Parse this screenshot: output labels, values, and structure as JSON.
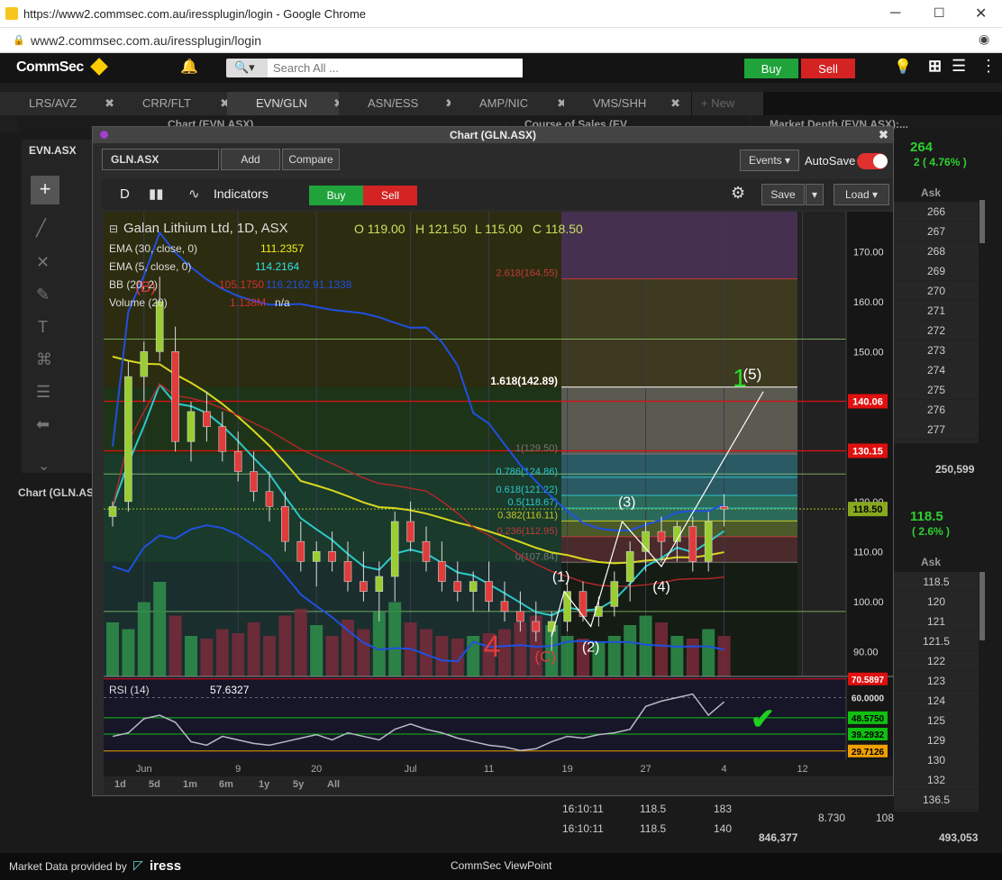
{
  "browser": {
    "tab_title": "https://www2.commsec.com.au/iressplugin/login - Google Chrome",
    "url": "www2.commsec.com.au/iressplugin/login"
  },
  "app": {
    "logo": "CommSec",
    "search_placeholder": "Search All ...",
    "buy_label": "Buy",
    "sell_label": "Sell"
  },
  "tabs": [
    {
      "label": "LRS/AVZ"
    },
    {
      "label": "CRR/FLT"
    },
    {
      "label": "EVN/GLN"
    },
    {
      "label": "ASN/ESS"
    },
    {
      "label": "AMP/NIC"
    },
    {
      "label": "VMS/SHH"
    },
    {
      "label": "+ New"
    }
  ],
  "panels": {
    "left_chart": "Chart (EVN.ASX)",
    "course_of_sales": "Course of Sales (EV...",
    "market_depth": "Market Depth (EVN.ASX):...",
    "left_symbol": "EVN.ASX",
    "left_bottom": "Chart (GLN.ASX)"
  },
  "depth_top": {
    "price": "264",
    "change": "2 ( 4.76% )",
    "ask_header": "Ask",
    "asks": [
      "266",
      "267",
      "268",
      "269",
      "270",
      "271",
      "272",
      "273",
      "274",
      "275",
      "276",
      "277"
    ],
    "total": "250,599"
  },
  "depth_bottom": {
    "price": "118.5",
    "change": "( 2.6% )",
    "ask_header": "Ask",
    "asks": [
      "118.5",
      "120",
      "121",
      "121.5",
      "122",
      "123",
      "124",
      "125",
      "129",
      "130",
      "132",
      "136.5"
    ],
    "bid_price": "8.730",
    "bid_vol": "108",
    "total_left": "846,377",
    "total_right": "493,053"
  },
  "course_of_sales_rows": [
    {
      "time": "16:10:11",
      "price": "118.5",
      "vol": "183"
    },
    {
      "time": "16:10:11",
      "price": "118.5",
      "vol": "140"
    }
  ],
  "modal": {
    "title": "Chart (GLN.ASX)",
    "symbol": "GLN.ASX",
    "add_label": "Add",
    "compare_label": "Compare",
    "events_label": "Events",
    "autosave_label": "AutoSave",
    "period_label": "D",
    "indicators_label": "Indicators",
    "buy_label": "Buy",
    "sell_label": "Sell",
    "save_label": "Save",
    "load_label": "Load"
  },
  "timeframes": [
    "1d",
    "5d",
    "1m",
    "6m",
    "1y",
    "5y",
    "All"
  ],
  "footer": {
    "provided_by": "Market Data provided by",
    "brand": "iress",
    "app_name": "CommSec ViewPoint"
  },
  "chart_data": {
    "type": "candlestick",
    "title": "Galan Lithium Ltd, 1D, ASX",
    "ohlc_header": {
      "o": "O 119.00",
      "h": "H 121.50",
      "l": "L 115.00",
      "c": "C 118.50"
    },
    "ylim": [
      85,
      178
    ],
    "yticks": [
      90,
      100,
      110,
      120,
      130,
      140,
      150,
      160,
      170
    ],
    "ytick_labels": [
      "90.00",
      "100.00",
      "110.00",
      "120.00",
      "130.00",
      "140.00",
      "150.00",
      "160.00",
      "170.00"
    ],
    "xticks": [
      {
        "i": 2,
        "label": "Jun"
      },
      {
        "i": 8,
        "label": "9"
      },
      {
        "i": 13,
        "label": "20"
      },
      {
        "i": 19,
        "label": "Jul"
      },
      {
        "i": 24,
        "label": "11"
      },
      {
        "i": 29,
        "label": "19"
      },
      {
        "i": 34,
        "label": "27"
      },
      {
        "i": 39,
        "label": "4"
      },
      {
        "i": 44,
        "label": "12"
      }
    ],
    "candles": [
      [
        117,
        120,
        115,
        119
      ],
      [
        120,
        148,
        118,
        145
      ],
      [
        145,
        152,
        140,
        150
      ],
      [
        150,
        165,
        148,
        160
      ],
      [
        150,
        155,
        130,
        132
      ],
      [
        132,
        140,
        128,
        138
      ],
      [
        138,
        142,
        132,
        135
      ],
      [
        135,
        138,
        128,
        130
      ],
      [
        130,
        134,
        124,
        126
      ],
      [
        126,
        130,
        120,
        122
      ],
      [
        122,
        126,
        116,
        119
      ],
      [
        119,
        122,
        110,
        112
      ],
      [
        112,
        116,
        106,
        108
      ],
      [
        108,
        112,
        103,
        110
      ],
      [
        110,
        114,
        106,
        108
      ],
      [
        108,
        112,
        102,
        104
      ],
      [
        104,
        110,
        100,
        102
      ],
      [
        102,
        108,
        96,
        105
      ],
      [
        105,
        118,
        100,
        116
      ],
      [
        116,
        120,
        110,
        112
      ],
      [
        112,
        115,
        106,
        108
      ],
      [
        108,
        112,
        102,
        104
      ],
      [
        104,
        108,
        100,
        102
      ],
      [
        102,
        106,
        98,
        104
      ],
      [
        104,
        108,
        98,
        100
      ],
      [
        100,
        104,
        96,
        98
      ],
      [
        98,
        102,
        94,
        96
      ],
      [
        96,
        100,
        92,
        94
      ],
      [
        94,
        98,
        90,
        96
      ],
      [
        96,
        104,
        94,
        102
      ],
      [
        102,
        104,
        96,
        97
      ],
      [
        97,
        101,
        95,
        99
      ],
      [
        99,
        106,
        97,
        104
      ],
      [
        104,
        112,
        100,
        110
      ],
      [
        110,
        116,
        106,
        114
      ],
      [
        114,
        117,
        108,
        112
      ],
      [
        112,
        116,
        108,
        115
      ],
      [
        115,
        117,
        106,
        108
      ],
      [
        108,
        118,
        106,
        116
      ],
      [
        119,
        121.5,
        115,
        118.5
      ]
    ],
    "volumes": [
      40,
      35,
      55,
      70,
      45,
      30,
      28,
      35,
      32,
      40,
      30,
      45,
      50,
      38,
      30,
      42,
      35,
      48,
      55,
      40,
      35,
      30,
      28,
      30,
      32,
      35,
      40,
      45,
      38,
      30,
      28,
      25,
      30,
      38,
      45,
      40,
      30,
      28,
      35,
      30
    ],
    "series": [
      {
        "name": "EMA (30, close, 0)",
        "value": "111.2357",
        "color": "#d8d820"
      },
      {
        "name": "EMA (5, close, 0)",
        "value": "114.2164",
        "color": "#2cc8c8"
      },
      {
        "name": "BB (20, 2)",
        "values": [
          "105.1750",
          "116.2162",
          "91.1338"
        ],
        "color": "#2050e0"
      },
      {
        "name": "Volume (20)",
        "values": [
          "1.138M",
          "n/a"
        ],
        "color": "#c03030"
      }
    ],
    "fib_levels": [
      {
        "label": "2.618(164.55)",
        "v": 164.55,
        "color": "#c03a3a"
      },
      {
        "label": "1.618(142.89)",
        "v": 142.89,
        "color": "#ffffff"
      },
      {
        "label": "1(129.50)",
        "v": 129.5,
        "color": "#777777"
      },
      {
        "label": "0.786(124.86)",
        "v": 124.86,
        "color": "#2cc8c8"
      },
      {
        "label": "0.618(121.22)",
        "v": 121.22,
        "color": "#2cc8c8"
      },
      {
        "label": "0.5(118.67)",
        "v": 118.67,
        "color": "#2cc8c8"
      },
      {
        "label": "0.382(116.11)",
        "v": 116.11,
        "color": "#c8c820"
      },
      {
        "label": "0.236(112.95)",
        "v": 112.95,
        "color": "#c03a3a"
      },
      {
        "label": "0(107.84)",
        "v": 107.84,
        "color": "#777777"
      }
    ],
    "price_tags": [
      {
        "label": "140.06",
        "v": 140.06,
        "bg": "#e01010",
        "fg": "#ffffff"
      },
      {
        "label": "130.15",
        "v": 130.15,
        "bg": "#e01010",
        "fg": "#ffffff"
      },
      {
        "label": "118.50",
        "v": 118.5,
        "bg": "#88a820",
        "fg": "#000000"
      }
    ],
    "wave_labels": [
      "(B)",
      "(1)",
      "(2)",
      "(3)",
      "(4)",
      "(5)",
      "1",
      "4",
      "(C)"
    ],
    "rsi": {
      "name": "RSI (14)",
      "value": "57.6327",
      "ylim": [
        25,
        72
      ],
      "levels": [
        {
          "label": "70.5897",
          "v": 70.59,
          "bg": "#e01010"
        },
        {
          "label": "60.0000",
          "v": 60,
          "bg": ""
        },
        {
          "label": "48.5750",
          "v": 48.575,
          "bg": "#10c010"
        },
        {
          "label": "39.2932",
          "v": 39.29,
          "bg": "#10c010"
        },
        {
          "label": "29.7126",
          "v": 29.71,
          "bg": "#f0a000"
        }
      ],
      "values": [
        38,
        40,
        48,
        50,
        46,
        35,
        33,
        38,
        36,
        34,
        33,
        35,
        37,
        39,
        36,
        40,
        38,
        36,
        42,
        45,
        42,
        40,
        37,
        35,
        33,
        32,
        30,
        31,
        35,
        38,
        37,
        39,
        40,
        42,
        55,
        58,
        60,
        62,
        50,
        57.6
      ]
    }
  }
}
